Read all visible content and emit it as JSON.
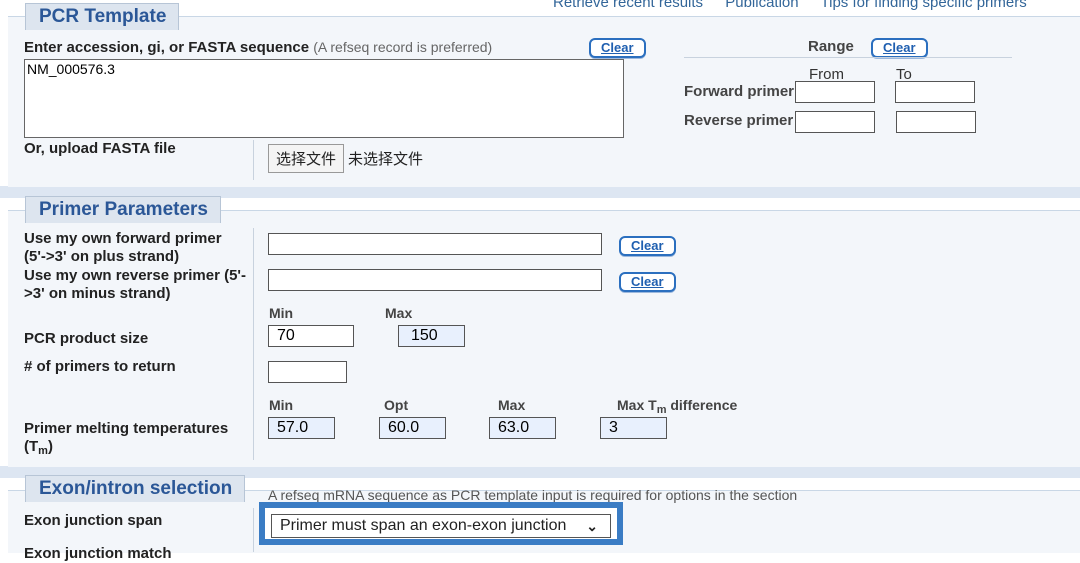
{
  "top_links": [
    "Retrieve recent results",
    "Publication",
    "Tips for finding specific primers"
  ],
  "pcr_template": {
    "legend": "PCR Template",
    "accession_label": "Enter accession, gi, or FASTA sequence",
    "accession_note": "(A refseq record is preferred)",
    "clear_label": "Clear",
    "sequence_value": "NM_000576.3",
    "upload_label": "Or, upload FASTA file",
    "choose_file_label": "选择文件",
    "no_file_label": "未选择文件",
    "range": {
      "title": "Range",
      "clear_label": "Clear",
      "from_label": "From",
      "to_label": "To",
      "forward_label": "Forward primer",
      "reverse_label": "Reverse primer",
      "forward_from": "",
      "forward_to": "",
      "reverse_from": "",
      "reverse_to": ""
    }
  },
  "primer_params": {
    "legend": "Primer Parameters",
    "own_forward_label": "Use my own forward primer (5'->3' on plus strand)",
    "own_forward_line1": "Use my own forward primer",
    "own_forward_line2": "(5'->3' on plus strand)",
    "own_reverse_line1": "Use my own reverse primer (5'-",
    "own_reverse_line2": ">3' on minus strand)",
    "clear_label": "Clear",
    "own_forward_value": "",
    "own_reverse_value": "",
    "product_size": {
      "label": "PCR product size",
      "min_label": "Min",
      "max_label": "Max",
      "min_value": "70",
      "max_value": "150"
    },
    "num_primers": {
      "label": "# of primers to return",
      "value": ""
    },
    "melting": {
      "label_line1": "Primer melting temperatures",
      "label_line2_prefix": "(T",
      "label_line2_sub": "m",
      "label_line2_suffix": ")",
      "min_label": "Min",
      "opt_label": "Opt",
      "max_label": "Max",
      "diff_label_prefix": "Max T",
      "diff_label_sub": "m",
      "diff_label_suffix": " difference",
      "min_value": "57.0",
      "opt_value": "60.0",
      "max_value": "63.0",
      "diff_value": "3"
    }
  },
  "exon_intron": {
    "legend": "Exon/intron selection",
    "note": "A refseq mRNA sequence as PCR template input is required for options in the section",
    "junction_label": "Exon junction span",
    "junction_selected": "Primer must span an exon-exon junction",
    "next_label_partial": "Exon junction match"
  },
  "colors": {
    "accent": "#2b6fbf",
    "legend_text": "#2b5797",
    "panel_bg": "#f3f6fa",
    "highlight_border": "#3a7cc4"
  }
}
